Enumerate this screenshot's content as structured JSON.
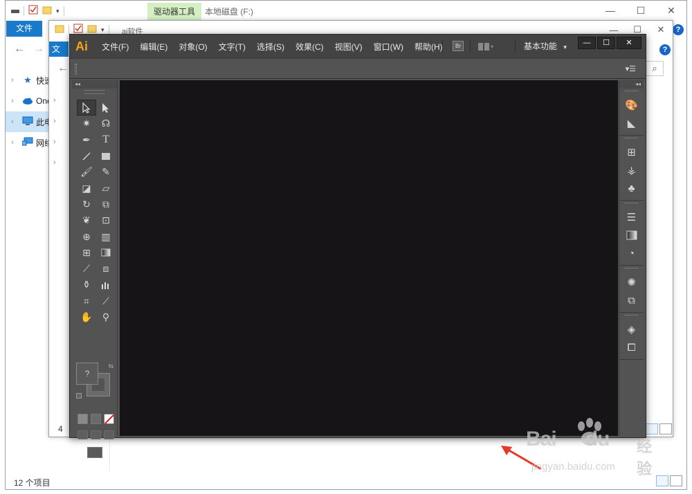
{
  "explorer_back": {
    "ribbon_context_tab": "驱动器工具",
    "title": "本地磁盘 (F:)",
    "file_tab": "文件",
    "nav_items": [
      {
        "label": "快速",
        "icon": "star-icon"
      },
      {
        "label": "One",
        "icon": "cloud-icon"
      },
      {
        "label": "此电",
        "icon": "computer-icon"
      },
      {
        "label": "网络",
        "icon": "network-icon"
      }
    ],
    "status": "12 个项目",
    "caption": {
      "minimize": "—",
      "maximize": "☐",
      "close": "✕"
    }
  },
  "explorer_front": {
    "title": "ai软件",
    "file_tab": "文",
    "status": "4",
    "caption": {
      "minimize": "—",
      "maximize": "☐",
      "close": "✕"
    }
  },
  "illustrator": {
    "logo": "Ai",
    "menus": [
      "文件(F)",
      "编辑(E)",
      "对象(O)",
      "文字(T)",
      "选择(S)",
      "效果(C)",
      "视图(V)",
      "窗口(W)",
      "帮助(H)"
    ],
    "bridge_button": "Br",
    "workspace": "基本功能",
    "caption": {
      "minimize": "—",
      "maximize": "☐",
      "close": "✕"
    },
    "color_fill_label": "?",
    "colors": {
      "menubar": "#434343",
      "panel": "#535353",
      "canvas": "#161417",
      "logo": "#f7a11a"
    }
  },
  "watermark": {
    "brand": "Bai",
    "brand2": "du",
    "brand_cn": "经验",
    "url": "jingyan.baidu.com"
  },
  "annotation_color": "#e33b2b"
}
